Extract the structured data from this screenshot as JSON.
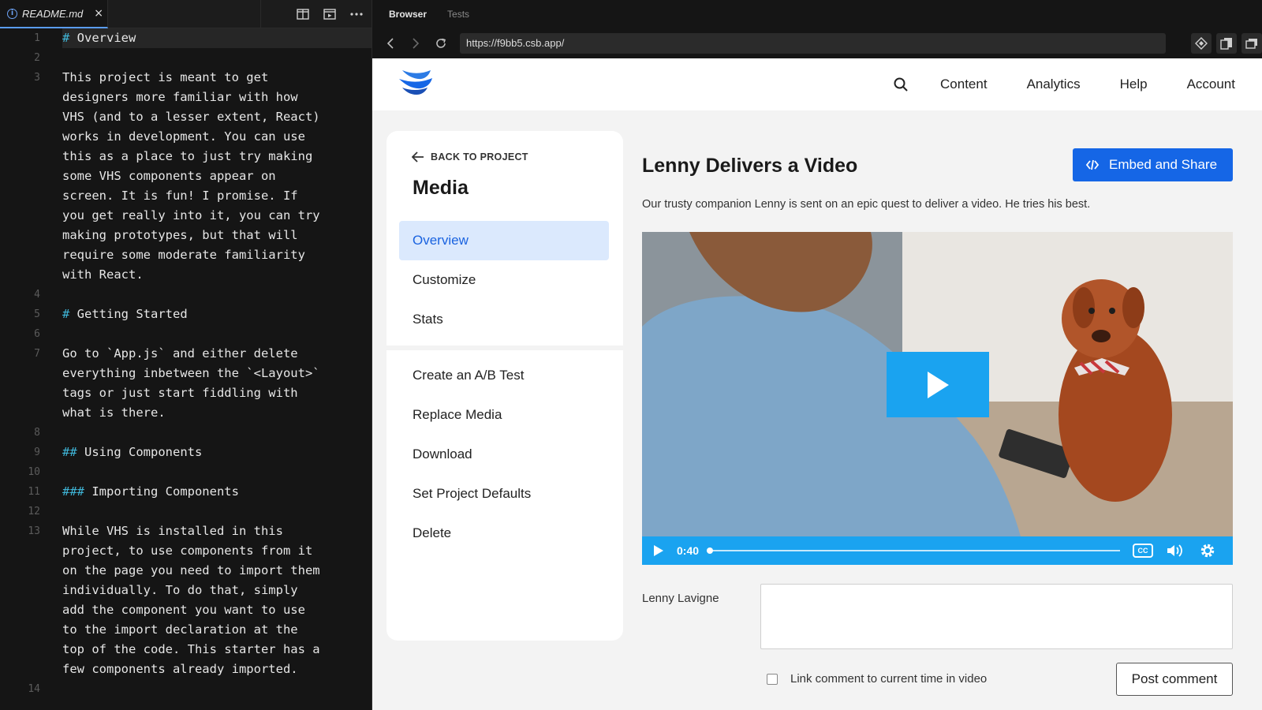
{
  "editor": {
    "file_tab": {
      "name": "README.md",
      "close": "×",
      "icon": "info-icon"
    },
    "actions": [
      "split-view-icon",
      "preview-icon",
      "more-icon"
    ],
    "lines": [
      {
        "n": "1",
        "text": "# Overview",
        "highlight": true
      },
      {
        "n": "2",
        "text": ""
      },
      {
        "n": "3",
        "text": "This project is meant to get"
      },
      {
        "n": "",
        "text": "designers more familiar with how"
      },
      {
        "n": "",
        "text": "VHS (and to a lesser extent, React)"
      },
      {
        "n": "",
        "text": "works in development. You can use"
      },
      {
        "n": "",
        "text": "this as a place to just try making"
      },
      {
        "n": "",
        "text": "some VHS components appear on"
      },
      {
        "n": "",
        "text": "screen. It is fun! I promise. If"
      },
      {
        "n": "",
        "text": "you get really into it, you can try"
      },
      {
        "n": "",
        "text": "making prototypes, but that will"
      },
      {
        "n": "",
        "text": "require some moderate familiarity"
      },
      {
        "n": "",
        "text": "with React."
      },
      {
        "n": "4",
        "text": ""
      },
      {
        "n": "5",
        "text": "# Getting Started"
      },
      {
        "n": "6",
        "text": ""
      },
      {
        "n": "7",
        "text": "Go to `App.js` and either delete"
      },
      {
        "n": "",
        "text": "everything inbetween the `<Layout>`"
      },
      {
        "n": "",
        "text": "tags or just start fiddling with"
      },
      {
        "n": "",
        "text": "what is there."
      },
      {
        "n": "8",
        "text": ""
      },
      {
        "n": "9",
        "text": "## Using Components"
      },
      {
        "n": "10",
        "text": ""
      },
      {
        "n": "11",
        "text": "### Importing Components"
      },
      {
        "n": "12",
        "text": ""
      },
      {
        "n": "13",
        "text": "While VHS is installed in this"
      },
      {
        "n": "",
        "text": "project, to use components from it"
      },
      {
        "n": "",
        "text": "on the page you need to import them"
      },
      {
        "n": "",
        "text": "individually. To do that, simply"
      },
      {
        "n": "",
        "text": "add the component you want to use"
      },
      {
        "n": "",
        "text": "to the import declaration at the"
      },
      {
        "n": "",
        "text": "top of the code. This starter has a"
      },
      {
        "n": "",
        "text": "few components already imported."
      },
      {
        "n": "14",
        "text": ""
      }
    ]
  },
  "browser": {
    "tabs": {
      "active": "Browser",
      "inactive": "Tests"
    },
    "url": "https://f9bb5.csb.app/"
  },
  "app": {
    "nav": {
      "content": "Content",
      "analytics": "Analytics",
      "help": "Help",
      "account": "Account"
    },
    "sidebar": {
      "back": "BACK TO PROJECT",
      "title": "Media",
      "items": [
        {
          "label": "Overview",
          "active": true
        },
        {
          "label": "Customize"
        },
        {
          "label": "Stats"
        },
        {
          "label": "Create an A/B Test"
        },
        {
          "label": "Replace Media"
        },
        {
          "label": "Download"
        },
        {
          "label": "Set Project Defaults"
        },
        {
          "label": "Delete"
        }
      ]
    },
    "media": {
      "title": "Lenny Delivers a Video",
      "embed_label": "Embed and Share",
      "description": "Our trusty companion Lenny is sent on an epic quest to deliver a video. He tries his best.",
      "player": {
        "time": "0:40",
        "cc": "CC",
        "progress": 0.0
      }
    },
    "comment": {
      "author": "Lenny Lavigne",
      "link_label": "Link comment to current time in video",
      "post_label": "Post comment"
    }
  },
  "colors": {
    "accent": "#1566e6",
    "player": "#1aa3f0",
    "active_bg": "#dbe9fd",
    "code_hash": "#3fb6d8"
  }
}
